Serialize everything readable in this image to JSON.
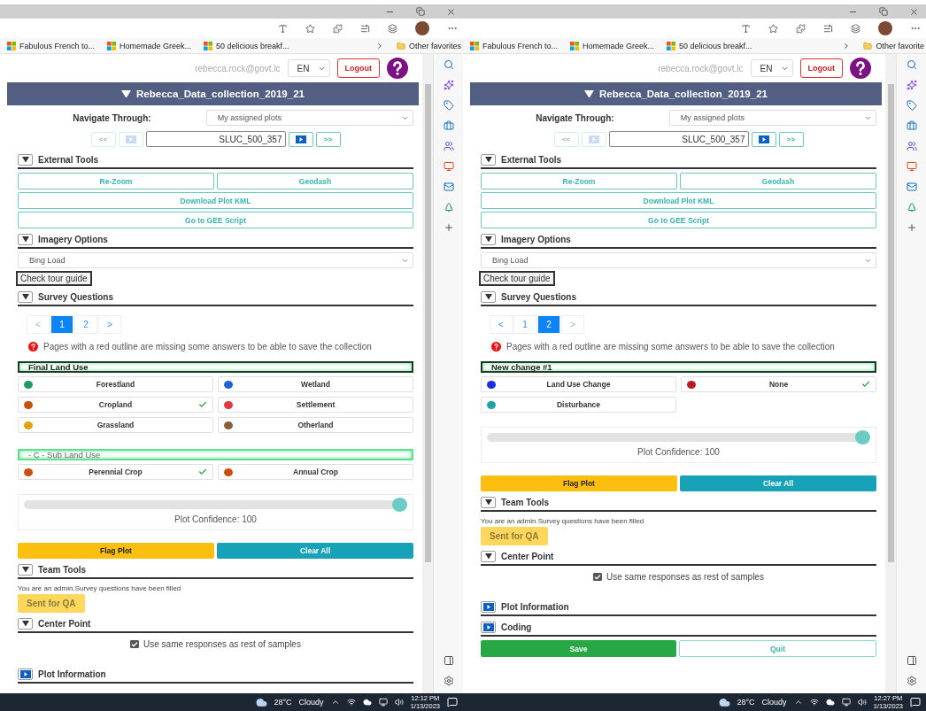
{
  "panels": [
    {
      "bookmarks": [
        "Fabulous French to...",
        "Homemade Greek...",
        "50 delicious breakf..."
      ],
      "other_favorites": "Other favorites",
      "user": {
        "email": "rebecca.rock@govt.lc",
        "language": "EN",
        "logout": "Logout"
      },
      "project_title": "Rebecca_Data_collection_2019_21",
      "navigate": {
        "label": "Navigate Through:",
        "mode": "My assigned plots",
        "plot_id": "SLUC_500_357",
        "first": {
          "label": "<<",
          "disabled": true
        },
        "last": {
          "label": ">>",
          "disabled": false
        }
      },
      "external_tools": {
        "title": "External Tools",
        "expanded": true,
        "buttons": [
          [
            "Re-Zoom",
            "Geodash"
          ],
          [
            "Download Plot KML"
          ],
          [
            "Go to GEE Script"
          ]
        ]
      },
      "imagery": {
        "title": "Imagery Options",
        "expanded": true,
        "source": "Bing Load"
      },
      "tour_button": "Check tour guide",
      "survey": {
        "title": "Survey Questions",
        "expanded": true,
        "pages": [
          {
            "label": "<",
            "selected": false,
            "disabled": true
          },
          {
            "label": "1",
            "selected": true,
            "disabled": false
          },
          {
            "label": "2",
            "selected": false,
            "disabled": false
          },
          {
            "label": ">",
            "selected": false,
            "disabled": false
          }
        ],
        "note": "Pages with a red outline are missing some answers to be able to save the collection",
        "groups": [
          {
            "title": "Final Land Use",
            "active": true,
            "options": [
              {
                "label": "Forestland",
                "color": "#1e9a64",
                "checked": false
              },
              {
                "label": "Wetland",
                "color": "#1c64d4",
                "checked": false
              },
              {
                "label": "Cropland",
                "color": "#c94f0c",
                "checked": true
              },
              {
                "label": "Settlement",
                "color": "#e03a3e",
                "checked": false
              },
              {
                "label": "Grassland",
                "color": "#e0a20e",
                "checked": false
              },
              {
                "label": "Otherland",
                "color": "#87603a",
                "checked": false
              }
            ]
          },
          {
            "title": "- C - Sub Land Use",
            "active": false,
            "options": [
              {
                "label": "Perennial Crop",
                "color": "#c94f0c",
                "checked": true
              },
              {
                "label": "Annual Crop",
                "color": "#c94f0c",
                "checked": false
              }
            ]
          }
        ],
        "confidence": {
          "level": 1,
          "label": "Plot Confidence: 100"
        },
        "actions": [
          {
            "label": "Flag Plot",
            "kind": "flag"
          },
          {
            "label": "Clear All",
            "kind": "clear"
          }
        ]
      },
      "team_tools": {
        "title": "Team Tools",
        "expanded": true,
        "message": "You are an admin.Survey questions have been filled",
        "qa_button": "Sent for QA"
      },
      "center_point": {
        "title": "Center Point",
        "expanded": true,
        "checkbox": {
          "label": "Use same responses as rest of samples",
          "checked": true
        }
      },
      "more_sections": [
        {
          "title": "Plot Information",
          "expanded": false
        }
      ],
      "taskbar": {
        "temperature": "28°C",
        "weather": "Cloudy",
        "time": "12:12 PM",
        "date": "1/13/2023"
      }
    },
    {
      "bookmarks": [
        "Fabulous French to...",
        "Homemade Greek...",
        "50 delicious breakf..."
      ],
      "other_favorites": "Other favorite",
      "user": {
        "email": "rebecca.rock@govt.lc",
        "language": "EN",
        "logout": "Logout"
      },
      "project_title": "Rebecca_Data_collection_2019_21",
      "navigate": {
        "label": "Navigate Through:",
        "mode": "My assigned plots",
        "plot_id": "SLUC_500_357",
        "first": {
          "label": "<<",
          "disabled": true
        },
        "last": {
          "label": ">>",
          "disabled": false
        }
      },
      "external_tools": {
        "title": "External Tools",
        "expanded": true,
        "buttons": [
          [
            "Re-Zoom",
            "Geodash"
          ],
          [
            "Download Plot KML"
          ],
          [
            "Go to GEE Script"
          ]
        ]
      },
      "imagery": {
        "title": "Imagery Options",
        "expanded": true,
        "source": "Bing Load"
      },
      "tour_button": "Check tour guide",
      "survey": {
        "title": "Survey Questions",
        "expanded": true,
        "pages": [
          {
            "label": "<",
            "selected": false,
            "disabled": false
          },
          {
            "label": "1",
            "selected": false,
            "disabled": false
          },
          {
            "label": "2",
            "selected": true,
            "disabled": false
          },
          {
            "label": ">",
            "selected": false,
            "disabled": true
          }
        ],
        "note": "Pages with a red outline are missing some answers to be able to save the collection",
        "groups": [
          {
            "title": "New change #1",
            "active": true,
            "options": [
              {
                "label": "Land Use Change",
                "color": "#1a2ee6",
                "checked": false
              },
              {
                "label": "None",
                "color": "#b81c24",
                "checked": true
              },
              {
                "label": "Disturbance",
                "color": "#1ea3a8",
                "checked": false
              }
            ]
          }
        ],
        "confidence": {
          "level": 1,
          "label": "Plot Confidence: 100"
        },
        "actions": [
          {
            "label": "Flag Plot",
            "kind": "flag"
          },
          {
            "label": "Clear All",
            "kind": "clear"
          }
        ]
      },
      "team_tools": {
        "title": "Team Tools",
        "expanded": true,
        "message": "You are an admin.Survey questions have been filled",
        "qa_button": "Sent for QA"
      },
      "center_point": {
        "title": "Center Point",
        "expanded": true,
        "checkbox": {
          "label": "Use same responses as rest of samples",
          "checked": true
        }
      },
      "more_sections": [
        {
          "title": "Plot Information",
          "expanded": false
        },
        {
          "title": "Coding",
          "expanded": false
        }
      ],
      "footer_buttons": [
        {
          "label": "Save",
          "kind": "save"
        },
        {
          "label": "Quit",
          "kind": "quit"
        }
      ],
      "taskbar": {
        "temperature": "28°C",
        "weather": "Cloudy",
        "time": "12:27 PM",
        "date": "1/13/2023"
      }
    }
  ]
}
